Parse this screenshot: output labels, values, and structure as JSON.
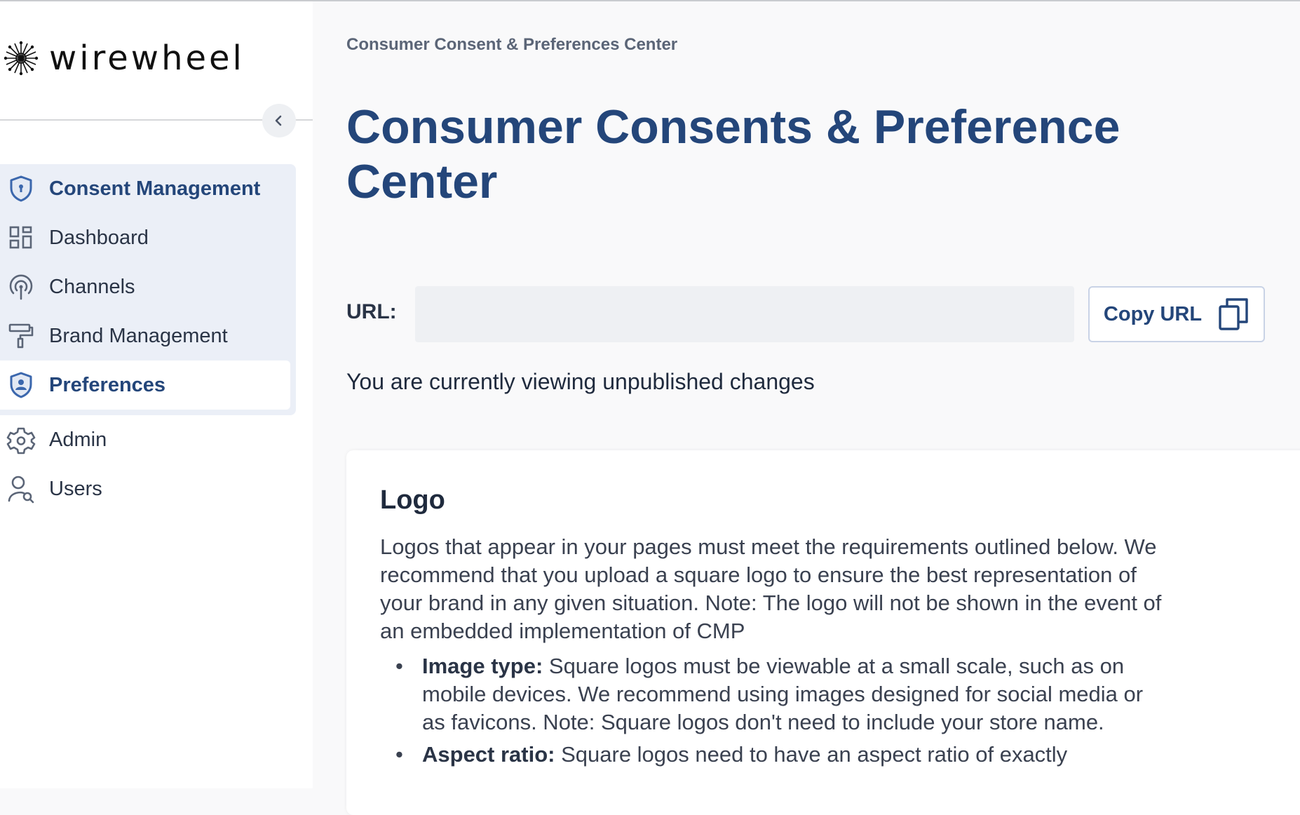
{
  "brand": {
    "name": "wirewheel"
  },
  "sidebar": {
    "section_header": "Consent Management",
    "items": [
      {
        "label": "Dashboard",
        "icon": "dashboard-icon"
      },
      {
        "label": "Channels",
        "icon": "broadcast-icon"
      },
      {
        "label": "Brand Management",
        "icon": "paint-roller-icon"
      },
      {
        "label": "Preferences",
        "icon": "user-shield-icon",
        "active": true
      }
    ],
    "admin_items": [
      {
        "label": "Admin",
        "icon": "gear-icon"
      },
      {
        "label": "Users",
        "icon": "user-search-icon"
      }
    ]
  },
  "main": {
    "breadcrumb": "Consumer Consent & Preferences Center",
    "title": "Consumer Consents & Preference Center",
    "url_label": "URL:",
    "url_value": "",
    "copy_button": "Copy URL",
    "unpublished_notice": "You are currently viewing unpublished changes",
    "logo_card": {
      "title": "Logo",
      "description": "Logos that appear in your pages must meet the requirements outlined below. We recommend that you upload a square logo to ensure the best representation of your brand in any given situation. Note: The logo will not be shown in the event of an embedded implementation of CMP",
      "requirements": [
        {
          "term": "Image type:",
          "text": " Square logos must be viewable at a small scale, such as on mobile devices. We recommend using images designed for social media or as favicons. Note: Square logos don't need to include your store name."
        },
        {
          "term": "Aspect ratio:",
          "text": " Square logos need to have an aspect ratio of exactly"
        }
      ]
    }
  },
  "colors": {
    "accent": "#24467a",
    "nav_bg": "#ebeff7",
    "page_bg": "#f9f9fa"
  }
}
